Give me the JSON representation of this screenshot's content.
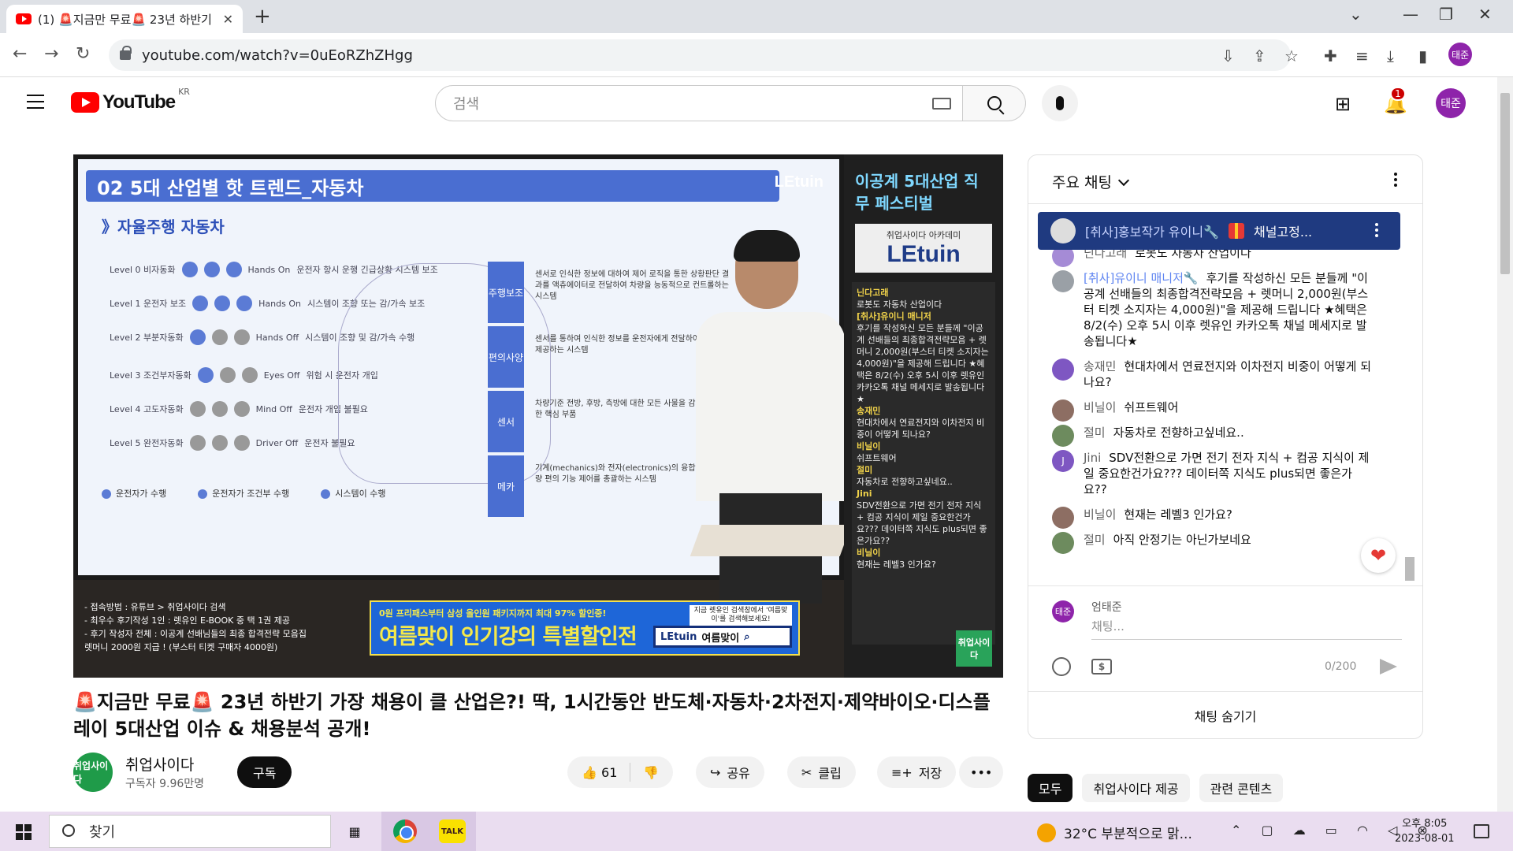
{
  "browser": {
    "tab_title": "(1) 🚨지금만 무료🚨 23년 하반기",
    "url": "youtube.com/watch?v=0uEoRZhZHgg",
    "profile_initial": "태준"
  },
  "yt_header": {
    "logo_text": "YouTube",
    "region": "KR",
    "search_placeholder": "검색",
    "notification_count": "1",
    "avatar_initial": "태준"
  },
  "video": {
    "slide_title": "02 5대 산업별 핫 트렌드_자동차",
    "slide_brand": "LEtuin",
    "slide_subtitle": "》자율주행 자동차",
    "levels": [
      {
        "label": "Level 0 비자동화",
        "hands": "Hands On",
        "desc": "운전자 항시 운행 긴급상황 시스템 보조"
      },
      {
        "label": "Level 1 운전자 보조",
        "hands": "Hands On",
        "desc": "시스템이 조향 또는 감/가속 보조"
      },
      {
        "label": "Level 2 부분자동화",
        "hands": "Hands Off",
        "desc": "시스템이 조향 및 감/가속 수행"
      },
      {
        "label": "Level 3 조건부자동화",
        "hands": "Eyes Off",
        "desc": "위험 시 운전자 개입"
      },
      {
        "label": "Level 4 고도자동화",
        "hands": "Mind Off",
        "desc": "운전자 개입 불필요"
      },
      {
        "label": "Level 5 완전자동화",
        "hands": "Driver Off",
        "desc": "운전자 불필요"
      }
    ],
    "categories": [
      {
        "name": "주행보조",
        "text": "센서로 인식한 정보에 대하여 제어 로직을 통한 상황판단 결과를 액츄에이터로 전달하여 차량을 능동적으로 컨트롤하는 시스템"
      },
      {
        "name": "편의사양",
        "text": "센서를 통하여 인식한 정보를 운전자에게 전달하여 편의를 제공하는 시스템"
      },
      {
        "name": "센서",
        "text": "차량기준 전방, 후방, 측방에 대한 모든 사물을 감지하기 위한 핵심 부품"
      },
      {
        "name": "메카",
        "text": "기계(mechanics)와 전자(electronics)의 융합기술로 차량 편의 기능 제어를 총괄하는 시스템"
      }
    ],
    "legend": [
      "운전자가 수행",
      "운전자가 조건부 수행",
      "시스템이 수행"
    ],
    "side_title": "이공계 5대산업 직무 페스티벌",
    "side_logo_top": "취업사이다 아카데미",
    "side_logo_main": "LEtuin",
    "side_chat": [
      {
        "name": "닌다고래",
        "text": "로봇도 자동차 산업이다"
      },
      {
        "name": "[취사]유이니 매니저",
        "text": "후기를 작성하신 모든 분들께 \"이공계 선배들의 최종합격전략모음 + 렛머니 2,000원(부스터 티켓 소지자는 4,000원)\"을 제공해 드립니다 ★혜택은 8/2(수) 오후 5시 이후 렛유인 카카오톡 채널 메세지로 발송됩니다★"
      },
      {
        "name": "송재민",
        "text": "현대차에서 연료전지와 이차전지 비중이 어떻게 되나요?"
      },
      {
        "name": "비닐이",
        "text": "쉬프트웨어"
      },
      {
        "name": "절미",
        "text": "자동차로 전향하고싶네요.."
      },
      {
        "name": "Jini",
        "text": "SDV전환으로 가면 전기 전자 지식 + 컴공 지식이 제일 중요한건가요??? 데이터쪽 지식도 plus되면 좋은가요??"
      },
      {
        "name": "비닐이",
        "text": "현재는 레벨3 인가요?"
      }
    ],
    "side_badge": "취업사이다",
    "caption_lines": [
      "- 접속방법 : 유튜브 > 취업사이다 검색",
      "- 최우수 후기작성 1인 : 렛유인 E-BOOK 중 택 1권 제공",
      "- 후기 작성자 전체 : 이공계 선배님들의 최종 합격전략 모음집",
      "  렛머니 2000원 지급 ! (부스터 티켓 구매자 4000원)"
    ],
    "banner_top": "0원 프리패스부터 삼성 올인원 패키지까지 최대 97% 할인중!",
    "banner_main": "여름맞이 인기강의 특별할인전",
    "banner_note": "지금 렛유인 검색창에서 '여름맞이'를 검색해보세요!",
    "banner_brand": "LEtuin",
    "banner_keyword": "여름맞이"
  },
  "meta": {
    "title": "🚨지금만 무료🚨 23년 하반기 가장 채용이 클 산업은?! 딱, 1시간동안 반도체·자동차·2차전지·제약바이오·디스플레이 5대산업 이슈 & 채용분석 공개!",
    "channel_name": "취업사이다",
    "channel_avatar": "취업사이다",
    "subscribers": "구독자 9.96만명",
    "subscribe_label": "구독",
    "likes": "61",
    "share_label": "공유",
    "clip_label": "클립",
    "save_label": "저장"
  },
  "chat": {
    "header_title": "주요 채팅",
    "pinned_name": "[취사]홍보작가 유이니🔧",
    "pinned_text": "채널고정...",
    "messages": [
      {
        "initial": "",
        "name": "닌다고래",
        "mod": false,
        "text": "로봇도 자동차 산업이다",
        "color": "#a58bd6"
      },
      {
        "initial": "",
        "name": "[취사]유이니 매니저🔧",
        "mod": true,
        "text": "후기를 작성하신 모든 분들께 \"이공계 선배들의 최종합격전략모음 + 렛머니 2,000원(부스터 티켓 소지자는 4,000원)\"을 제공해 드립니다 ★혜택은 8/2(수) 오후 5시 이후 렛유인 카카오톡 채널 메세지로 발송됩니다★",
        "color": "#9aa0a6"
      },
      {
        "initial": "",
        "name": "송재민",
        "mod": false,
        "text": "현대차에서 연료전지와 이차전지 비중이 어떻게 되나요?",
        "color": "#7e57c2"
      },
      {
        "initial": "",
        "name": "비닐이",
        "mod": false,
        "text": "쉬프트웨어",
        "color": "#8d6e63"
      },
      {
        "initial": "",
        "name": "절미",
        "mod": false,
        "text": "자동차로 전향하고싶네요..",
        "color": "#6d8b5e"
      },
      {
        "initial": "J",
        "name": "Jini",
        "mod": false,
        "text": "SDV전환으로 가면 전기 전자 지식 + 컴공 지식이 제일 중요한건가요??? 데이터쪽 지식도 plus되면 좋은가요??",
        "color": "#7e57c2"
      },
      {
        "initial": "",
        "name": "비닐이",
        "mod": false,
        "text": "현재는 레벨3 인가요?",
        "color": "#8d6e63"
      },
      {
        "initial": "",
        "name": "절미",
        "mod": false,
        "text": "아직 안정기는 아닌가보네요",
        "color": "#6d8b5e"
      }
    ],
    "user_initial": "태준",
    "user_name": "엄태준",
    "input_placeholder": "채팅...",
    "counter": "0/200",
    "hide_label": "채팅 숨기기"
  },
  "chips": [
    "모두",
    "취업사이다 제공",
    "관련 콘텐츠"
  ],
  "taskbar": {
    "search_label": "찾기",
    "kakao_label": "TALK",
    "weather": "32°C  부분적으로 맑...",
    "time": "오후 8:05",
    "date": "2023-08-01"
  },
  "colors": {
    "yt_red": "#ff0000",
    "pinned_bg": "#1f3a80",
    "avatar_purple": "#8e24aa",
    "channel_green": "#1f9b49"
  }
}
